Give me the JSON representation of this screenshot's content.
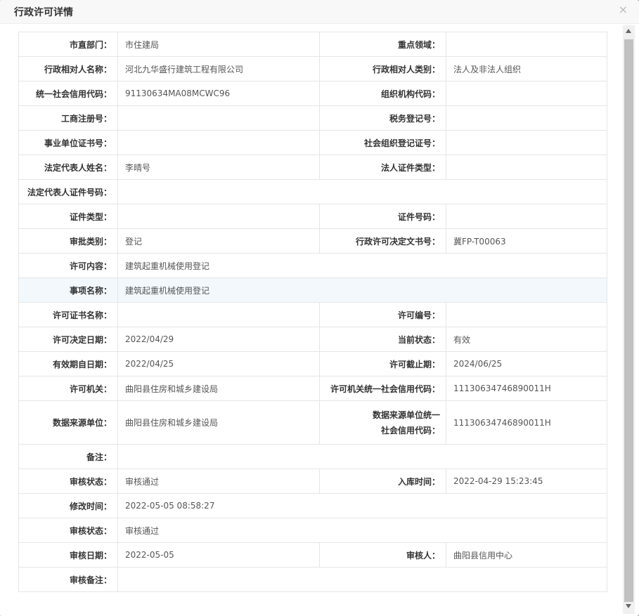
{
  "dialog": {
    "title": "行政许可详情",
    "close_glyph": "×"
  },
  "rows": [
    [
      {
        "label": "市直部门：",
        "value": "市住建局"
      },
      {
        "label": "重点领域：",
        "value": ""
      }
    ],
    [
      {
        "label": "行政相对人名称：",
        "value": "河北九华盛行建筑工程有限公司"
      },
      {
        "label": "行政相对人类别：",
        "value": "法人及非法人组织"
      }
    ],
    [
      {
        "label": "统一社会信用代码：",
        "value": "91130634MA08MCWC96"
      },
      {
        "label": "组织机构代码：",
        "value": ""
      }
    ],
    [
      {
        "label": "工商注册号：",
        "value": ""
      },
      {
        "label": "税务登记号：",
        "value": ""
      }
    ],
    [
      {
        "label": "事业单位证书号：",
        "value": ""
      },
      {
        "label": "社会组织登记证号：",
        "value": ""
      }
    ],
    [
      {
        "label": "法定代表人姓名：",
        "value": "李晴号"
      },
      {
        "label": "法人证件类型：",
        "value": ""
      }
    ],
    [
      {
        "label": "法定代表人证件号码：",
        "value": ""
      }
    ],
    [
      {
        "label": "证件类型：",
        "value": ""
      },
      {
        "label": "证件号码：",
        "value": ""
      }
    ],
    [
      {
        "label": "审批类别：",
        "value": "登记"
      },
      {
        "label": "行政许可决定文书号：",
        "value": "冀FP-T00063"
      }
    ],
    [
      {
        "label": "许可内容：",
        "value": "建筑起重机械使用登记"
      }
    ],
    [
      {
        "label": "事项名称：",
        "value": "建筑起重机械使用登记"
      }
    ],
    [
      {
        "label": "许可证书名称：",
        "value": ""
      },
      {
        "label": "许可编号：",
        "value": ""
      }
    ],
    [
      {
        "label": "许可决定日期：",
        "value": "2022/04/29"
      },
      {
        "label": "当前状态：",
        "value": "有效"
      }
    ],
    [
      {
        "label": "有效期自日期：",
        "value": "2022/04/25"
      },
      {
        "label": "许可截止期：",
        "value": "2024/06/25"
      }
    ],
    [
      {
        "label": "许可机关：",
        "value": "曲阳县住房和城乡建设局"
      },
      {
        "label": "许可机关统一社会信用代码：",
        "value": "11130634746890011H"
      }
    ],
    [
      {
        "label": "数据来源单位：",
        "value": "曲阳县住房和城乡建设局"
      },
      {
        "label_line1": "数据来源单位统一",
        "label_line2": "社会信用代码：",
        "value": "11130634746890011H"
      }
    ],
    [
      {
        "label": "备注：",
        "value": ""
      }
    ],
    [
      {
        "label": "审核状态：",
        "value": "审核通过"
      },
      {
        "label": "入库时间：",
        "value": "2022-04-29 15:23:45"
      }
    ],
    [
      {
        "label": "修改时间：",
        "value": "2022-05-05 08:58:27"
      }
    ],
    [
      {
        "label": "审核状态：",
        "value": "审核通过"
      }
    ],
    [
      {
        "label": "审核日期：",
        "value": "2022-05-05"
      },
      {
        "label": "审核人：",
        "value": "曲阳县信用中心"
      }
    ],
    [
      {
        "label": "审核备注：",
        "value": ""
      }
    ]
  ]
}
